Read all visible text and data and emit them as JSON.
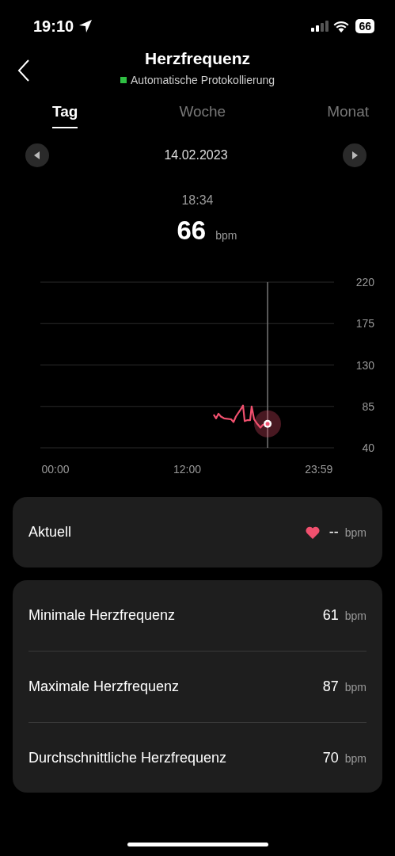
{
  "status_bar": {
    "time": "19:10",
    "battery": "66"
  },
  "header": {
    "title": "Herzfrequenz",
    "subtitle": "Automatische Protokollierung"
  },
  "tabs": [
    {
      "label": "Tag",
      "selected": true
    },
    {
      "label": "Woche",
      "selected": false
    },
    {
      "label": "Monat",
      "selected": false
    }
  ],
  "date_nav": {
    "date": "14.02.2023"
  },
  "reading": {
    "time": "18:34",
    "value": "66",
    "unit": "bpm"
  },
  "chart": {
    "chart_data": {
      "type": "line",
      "x": [
        14.41,
        14.63,
        14.85,
        15.06,
        15.35,
        16.0,
        16.22,
        16.43,
        16.94,
        17.08,
        17.23,
        17.44,
        17.73,
        17.87,
        18.09,
        18.38,
        18.67,
        18.88,
        19.32
      ],
      "series": [
        {
          "color": "#f0506e",
          "values": [
            76,
            72,
            77,
            74,
            72,
            71,
            68,
            74,
            83,
            86,
            69,
            70,
            70,
            85,
            71,
            66,
            62,
            65,
            66
          ]
        }
      ],
      "xlim": [
        -1.37,
        25.37
      ],
      "ylim": [
        40,
        220
      ],
      "grid": true,
      "ref_lines": [
        {
          "axis": "x",
          "value": 19.32
        }
      ],
      "xticks": [
        {
          "value": 0,
          "label": "00:00"
        },
        {
          "value": 12,
          "label": "12:00"
        },
        {
          "value": 23.98,
          "label": "23:59"
        }
      ],
      "yticks": [
        40,
        85,
        130,
        175,
        220
      ]
    }
  },
  "current": {
    "label": "Aktuell",
    "value": "--",
    "unit": "bpm"
  },
  "stats": [
    {
      "label": "Minimale Herzfrequenz",
      "value": "61",
      "unit": "bpm"
    },
    {
      "label": "Maximale Herzfrequenz",
      "value": "87",
      "unit": "bpm"
    },
    {
      "label": "Durchschnittliche Herzfrequenz",
      "value": "70",
      "unit": "bpm"
    }
  ]
}
